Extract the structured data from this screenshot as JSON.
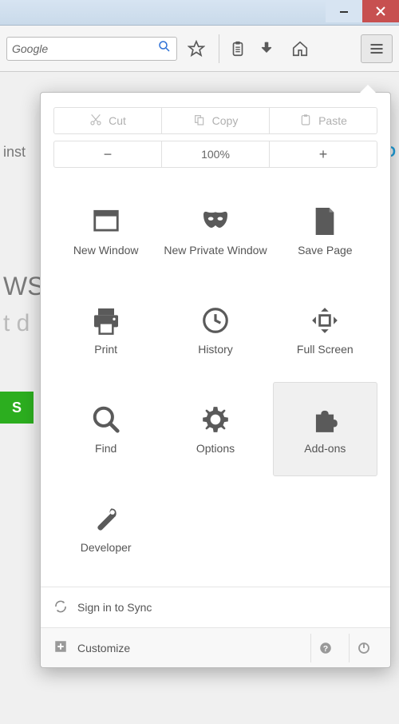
{
  "search": {
    "placeholder": "Google"
  },
  "edit": {
    "cut": "Cut",
    "copy": "Copy",
    "paste": "Paste"
  },
  "zoom": {
    "level": "100%"
  },
  "items": {
    "new_window": "New Window",
    "new_private": "New Private Window",
    "save_page": "Save Page",
    "print": "Print",
    "history": "History",
    "full_screen": "Full Screen",
    "find": "Find",
    "options": "Options",
    "addons": "Add-ons",
    "developer": "Developer"
  },
  "footer": {
    "sync": "Sign in to Sync",
    "customize": "Customize"
  },
  "bg": {
    "frag1": "inst",
    "frag2": "WS",
    "frag3": "t d",
    "frag4": "S",
    "frag5": "D"
  }
}
